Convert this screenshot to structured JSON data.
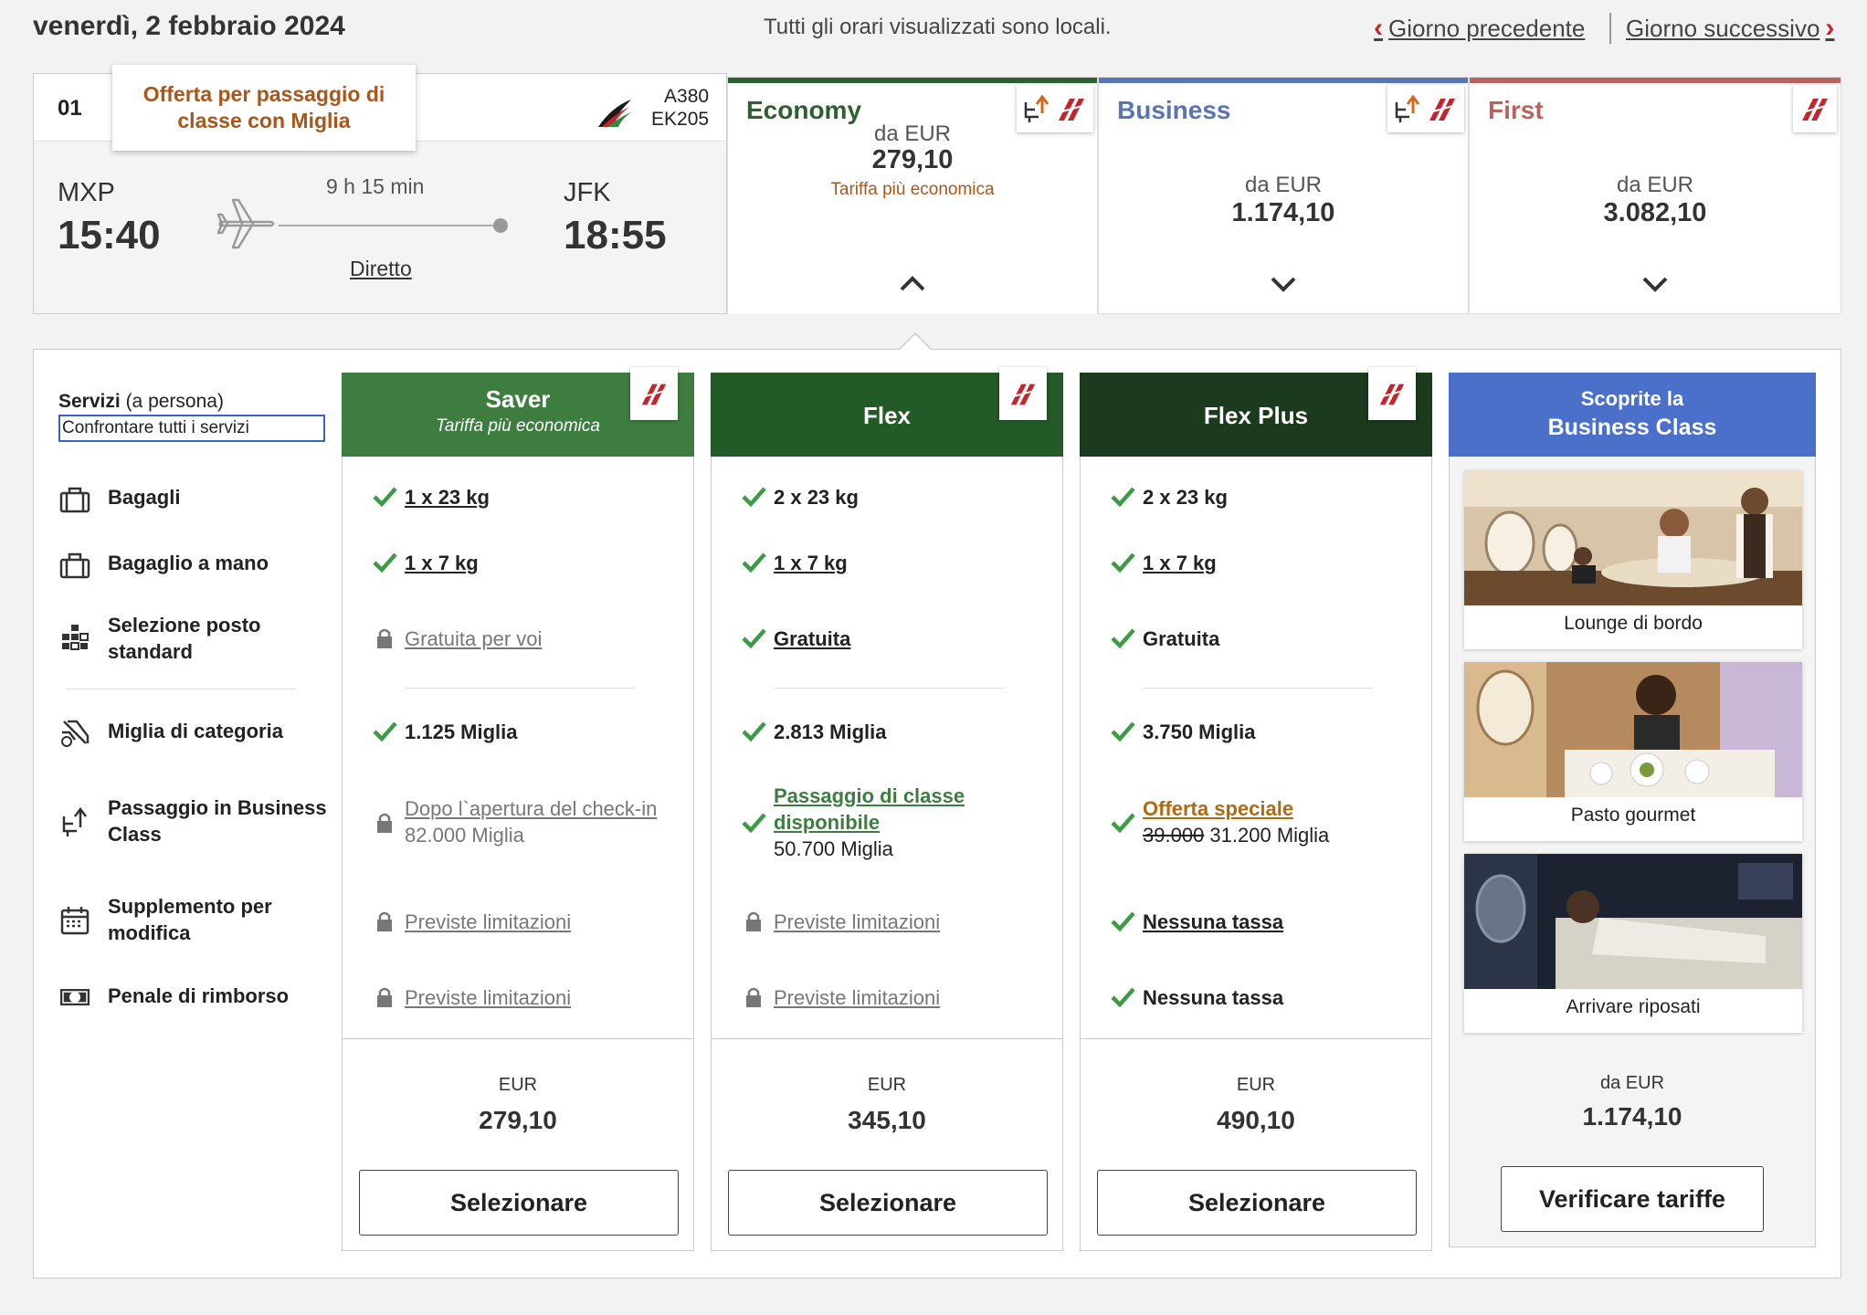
{
  "header": {
    "date": "venerdì, 2 febbraio 2024",
    "local_note": "Tutti gli orari visualizzati sono locali.",
    "prev_day": "Giorno precedente",
    "next_day": "Giorno successivo"
  },
  "flight": {
    "index": "01",
    "offer_label": "Offerta per passaggio di classe con Miglia",
    "aircraft": "A380",
    "flight_number": "EK205",
    "departure_code": "MXP",
    "departure_time": "15:40",
    "arrival_code": "JFK",
    "arrival_time": "18:55",
    "duration": "9 h 15 min",
    "stops": "Diretto"
  },
  "classes": [
    {
      "name": "Economy",
      "from": "da EUR",
      "price": "279,10",
      "note": "Tariffa più economica",
      "color": "#2e5f30",
      "expanded": true
    },
    {
      "name": "Business",
      "from": "da EUR",
      "price": "1.174,10",
      "color": "#5a75b4",
      "expanded": false
    },
    {
      "name": "First",
      "from": "da EUR",
      "price": "3.082,10",
      "color": "#b9625f",
      "expanded": false
    }
  ],
  "services": {
    "title": "Servizi",
    "title_note": "(a persona)",
    "compare_link": "Confrontare tutti i servizi",
    "items": [
      {
        "label": "Bagagli",
        "icon": "suitcase-icon"
      },
      {
        "label": "Bagaglio a mano",
        "icon": "hand-luggage-icon"
      },
      {
        "label": "Selezione posto standard",
        "icon": "seat-grid-icon"
      },
      {
        "label": "Miglia di categoria",
        "icon": "miles-plane-icon"
      },
      {
        "label": "Passaggio in Business Class",
        "icon": "upgrade-seat-icon"
      },
      {
        "label": "Supplemento per modifica",
        "icon": "calendar-icon"
      },
      {
        "label": "Penale di rimborso",
        "icon": "banknote-icon"
      }
    ]
  },
  "fares": [
    {
      "name": "Saver",
      "subtitle": "Tariffa più economica",
      "color": "#3d7d3f",
      "baggage": "1 x 23 kg",
      "hand_baggage": "1 x 7 kg",
      "seat": "Gratuita per voi",
      "miles": "1.125 Miglia",
      "upgrade_link": "Dopo l`apertura del check-in",
      "upgrade_miles": "82.000 Miglia",
      "change_fee": "Previste limitazioni",
      "refund_fee": "Previste limitazioni",
      "currency": "EUR",
      "price": "279,10",
      "button": "Selezionare"
    },
    {
      "name": "Flex",
      "color": "#245a27",
      "baggage": "2 x 23 kg",
      "hand_baggage": "1 x 7 kg",
      "seat": "Gratuita",
      "miles": "2.813 Miglia",
      "upgrade_link": "Passaggio di classe disponibile",
      "upgrade_miles": "50.700 Miglia",
      "change_fee": "Previste limitazioni",
      "refund_fee": "Previste limitazioni",
      "currency": "EUR",
      "price": "345,10",
      "button": "Selezionare"
    },
    {
      "name": "Flex Plus",
      "color": "#1b3a1e",
      "baggage": "2 x 23 kg",
      "hand_baggage": "1 x 7 kg",
      "seat": "Gratuita",
      "miles": "3.750 Miglia",
      "upgrade_link": "Offerta speciale",
      "upgrade_old_miles": "39.000",
      "upgrade_miles": "31.200 Miglia",
      "change_fee": "Nessuna tassa",
      "refund_fee": "Nessuna tassa",
      "currency": "EUR",
      "price": "490,10",
      "button": "Selezionare"
    }
  ],
  "promo": {
    "line1": "Scoprite la",
    "line2": "Business Class",
    "cards": [
      "Lounge di bordo",
      "Pasto gourmet",
      "Arrivare riposati"
    ],
    "from": "da EUR",
    "price": "1.174,10",
    "button": "Verificare tariffe"
  }
}
